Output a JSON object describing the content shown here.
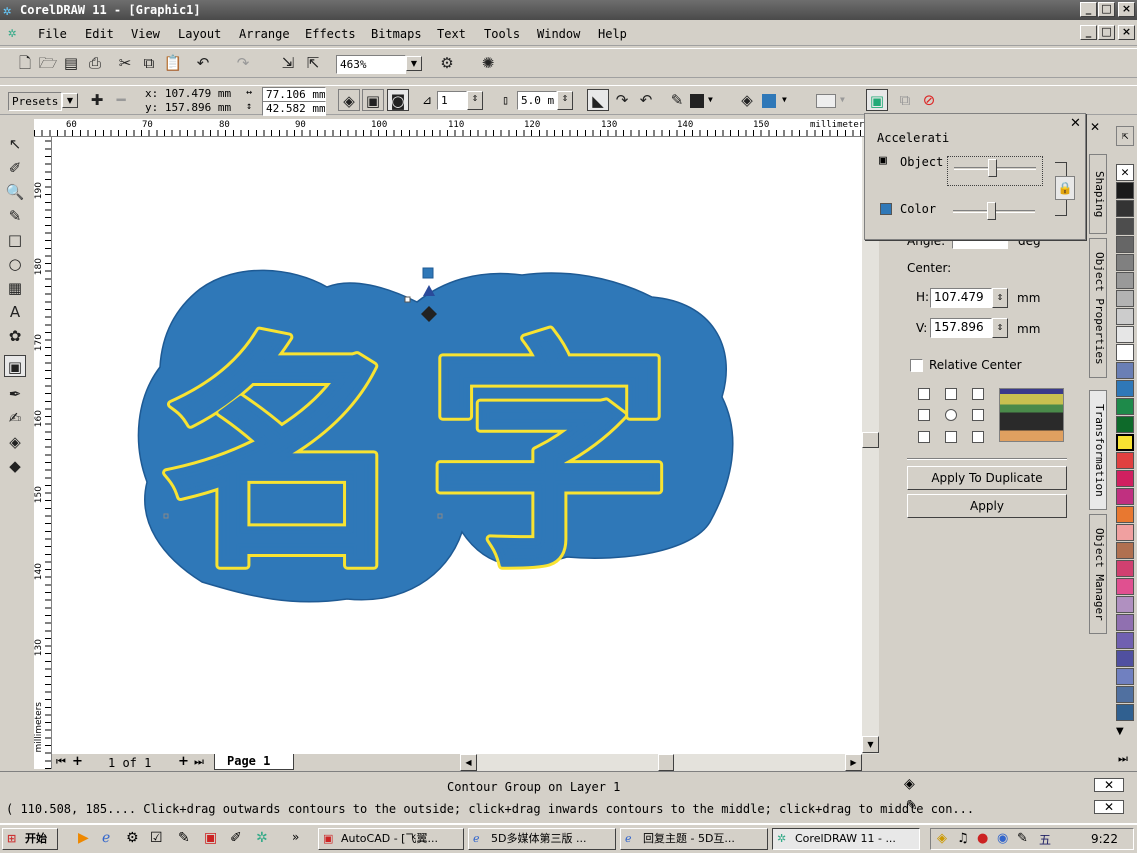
{
  "window": {
    "title": "CorelDRAW 11 - [Graphic1]",
    "min": "_",
    "max": "□",
    "close": "×"
  },
  "menu": [
    "File",
    "Edit",
    "View",
    "Layout",
    "Arrange",
    "Effects",
    "Bitmaps",
    "Text",
    "Tools",
    "Window",
    "Help"
  ],
  "toolbar": {
    "zoom": "463%"
  },
  "propbar": {
    "presets": "Presets",
    "x": "x: 107.479 mm",
    "y": "y: 157.896 mm",
    "w": "77.106 mm",
    "h": "42.582 mm",
    "steps": "1",
    "offset": "5.0 m"
  },
  "ruler": {
    "h_ticks": [
      "60",
      "70",
      "80",
      "90",
      "100",
      "110",
      "120",
      "130",
      "140",
      "150"
    ],
    "unit": "millimeters",
    "v_ticks": [
      "190",
      "180",
      "170",
      "160",
      "150",
      "140",
      "130"
    ],
    "v_unit": "millimeters"
  },
  "pages": {
    "counter": "1 of 1",
    "tab": "Page 1"
  },
  "accel": {
    "title": "Accelerati",
    "object": "Object",
    "color": "Color"
  },
  "transform": {
    "angle": "Angle:",
    "angle_unit": "deg",
    "center": "Center:",
    "h_label": "H:",
    "h_value": "107.479",
    "v_label": "V:",
    "v_value": "157.896",
    "unit": "mm",
    "relative": "Relative Center",
    "apply_dup": "Apply To Duplicate",
    "apply": "Apply"
  },
  "tabs": [
    "Shaping",
    "Object Properties",
    "Transformation",
    "Object Manager"
  ],
  "palette": [
    "#ffffff",
    "#1a1a1a",
    "#333333",
    "#4d4d4d",
    "#666666",
    "#808080",
    "#999999",
    "#b3b3b3",
    "#cccccc",
    "#e6e6e6",
    "#ffffff",
    "#2f6fb3",
    "#0099cc",
    "#009933",
    "#33cc33",
    "#ffff33",
    "#ff9933",
    "#ff3333",
    "#cc3366",
    "#ff66cc",
    "#ff9999",
    "#cc6699",
    "#996633",
    "#993333",
    "#ff6666",
    "#cc99cc",
    "#9966cc",
    "#6666cc",
    "#3333cc",
    "#9999ff",
    "#6699cc",
    "#336699"
  ],
  "status": {
    "line1": "Contour Group on Layer 1",
    "line2": "( 110.508, 185.... Click+drag outwards contours to the outside; click+drag inwards contours to the middle; click+drag to middle con..."
  },
  "taskbar": {
    "start": "开始",
    "tasks": [
      "AutoCAD - [飞翼...",
      "5D多媒体第三版 ...",
      "回复主题 - 5D互...",
      "CorelDRAW 11 - ..."
    ],
    "clock": "9:22"
  },
  "artwork": {
    "text": "名字",
    "fill": "#2f78b8",
    "outline": "#f8e332"
  }
}
